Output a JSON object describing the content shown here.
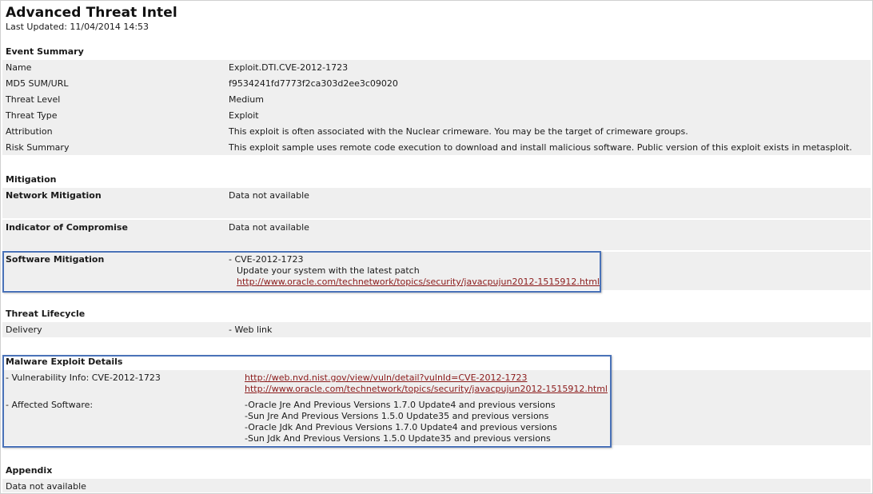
{
  "header": {
    "title": "Advanced Threat Intel",
    "last_updated": "Last Updated: 11/04/2014 14:53"
  },
  "event_summary": {
    "heading": "Event Summary",
    "rows": [
      {
        "label": "Name",
        "value": "Exploit.DTI.CVE-2012-1723"
      },
      {
        "label": "MD5 SUM/URL",
        "value": "f9534241fd7773f2ca303d2ee3c09020"
      },
      {
        "label": "Threat Level",
        "value": "Medium"
      },
      {
        "label": "Threat Type",
        "value": "Exploit"
      },
      {
        "label": "Attribution",
        "value": "This exploit is often associated with the Nuclear crimeware. You may be the target of crimeware groups."
      },
      {
        "label": "Risk Summary",
        "value": "This exploit sample uses remote code execution to download and install malicious software. Public version of this exploit exists in metasploit."
      }
    ]
  },
  "mitigation": {
    "heading": "Mitigation",
    "network": {
      "label": "Network Mitigation",
      "value": "Data not available"
    },
    "ioc": {
      "label": "Indicator of Compromise",
      "value": "Data not available"
    },
    "software": {
      "label": "Software Mitigation",
      "cve": "- CVE-2012-1723",
      "advice": "Update your system with the latest patch",
      "link": "http://www.oracle.com/technetwork/topics/security/javacpujun2012-1515912.html"
    }
  },
  "threat_lifecycle": {
    "heading": "Threat Lifecycle",
    "delivery": {
      "label": "Delivery",
      "value": "- Web link"
    }
  },
  "malware_exploit": {
    "heading": "Malware Exploit Details",
    "vuln_label": "- Vulnerability Info: CVE-2012-1723",
    "vuln_links": [
      "http://web.nvd.nist.gov/view/vuln/detail?vulnId=CVE-2012-1723",
      "http://www.oracle.com/technetwork/topics/security/javacpujun2012-1515912.html"
    ],
    "affected_label": "- Affected Software:",
    "affected": [
      "-Oracle Jre And Previous Versions 1.7.0 Update4 and previous versions",
      "-Sun Jre And Previous Versions 1.5.0 Update35 and previous versions",
      "-Oracle Jdk And Previous Versions 1.7.0 Update4 and previous versions",
      "-Sun Jdk And Previous Versions 1.5.0 Update35 and previous versions"
    ]
  },
  "appendix": {
    "heading": "Appendix",
    "value": "Data not available"
  },
  "colors": {
    "row_bg": "#efefef",
    "highlight_border": "#4a72b8",
    "link": "#8b1a1a"
  }
}
